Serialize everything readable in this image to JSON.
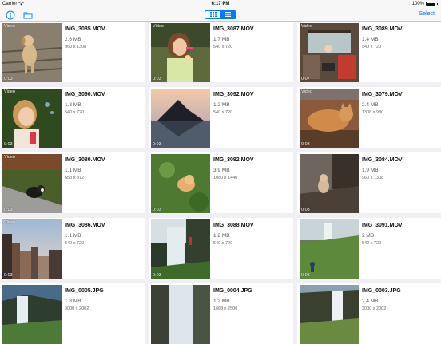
{
  "status": {
    "carrier": "Carrier",
    "time": "6:17 PM",
    "battery": "100%"
  },
  "nav": {
    "select_label": "Select"
  },
  "files": [
    {
      "name": "IMG_3085.MOV",
      "size": "2.6 MB",
      "dims": "960 x 1308",
      "video": "Video",
      "duration": "0:03",
      "scene": "dog"
    },
    {
      "name": "IMG_3087.MOV",
      "size": "1.7 MB",
      "dims": "540 x 720",
      "video": "Video",
      "duration": "0:03",
      "scene": "girl"
    },
    {
      "name": "IMG_3089.MOV",
      "size": "1.4 MB",
      "dims": "540 x 720",
      "video": "Video",
      "duration": "0:07",
      "scene": "car"
    },
    {
      "name": "IMG_3090.MOV",
      "size": "1.8 MB",
      "dims": "540 x 720",
      "video": "Video",
      "duration": "0:03",
      "scene": "girl2"
    },
    {
      "name": "IMG_3092.MOV",
      "size": "1.2 MB",
      "dims": "540 x 720",
      "video": "",
      "duration": "0:03",
      "scene": "mountain"
    },
    {
      "name": "IMG_3079.MOV",
      "size": "2.4 MB",
      "dims": "1308 x 980",
      "video": "Video",
      "duration": "0:03",
      "scene": "cat"
    },
    {
      "name": "IMG_3080.MOV",
      "size": "1.1 MB",
      "dims": "653 x 872",
      "video": "Video",
      "duration": "0:03",
      "scene": "dog2"
    },
    {
      "name": "IMG_3082.MOV",
      "size": "3.9 MB",
      "dims": "1080 x 1440",
      "video": "",
      "duration": "0:03",
      "scene": "dog3"
    },
    {
      "name": "IMG_3084.MOV",
      "size": "1.9 MB",
      "dims": "960 x 1308",
      "video": "",
      "duration": "0:03",
      "scene": "dog4"
    },
    {
      "name": "IMG_3086.MOV",
      "size": "1.1 MB",
      "dims": "540 x 720",
      "video": "Video",
      "duration": "0:03",
      "scene": "city"
    },
    {
      "name": "IMG_3088.MOV",
      "size": "1.2 MB",
      "dims": "540 x 720",
      "video": "",
      "duration": "0:03",
      "scene": "waterfall"
    },
    {
      "name": "IMG_3091.MOV",
      "size": "2 MB",
      "dims": "540 x 720",
      "video": "",
      "duration": "0:03",
      "scene": "waterfall2"
    },
    {
      "name": "IMG_0005.JPG",
      "size": "1.8 MB",
      "dims": "3000 x 2002",
      "video": "",
      "duration": "",
      "scene": "falls"
    },
    {
      "name": "IMG_0004.JPG",
      "size": "1.2 MB",
      "dims": "1668 x 2500",
      "video": "",
      "duration": "",
      "scene": "falls2"
    },
    {
      "name": "IMG_0003.JPG",
      "size": "2.4 MB",
      "dims": "3000 x 2002",
      "video": "",
      "duration": "",
      "scene": "falls3"
    }
  ]
}
